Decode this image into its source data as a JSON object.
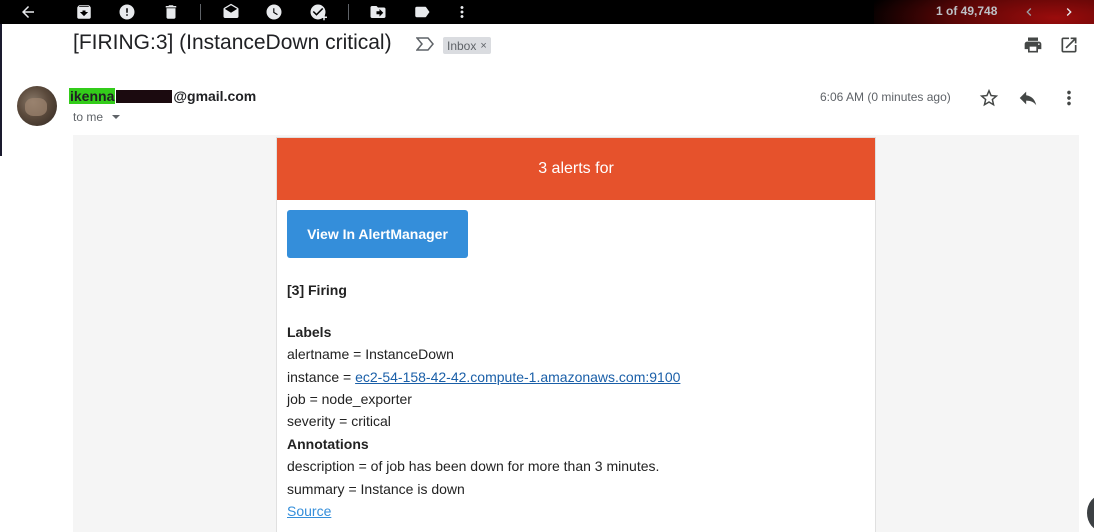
{
  "toolbar": {
    "page_count": "1 of 49,748",
    "icons": [
      "back-arrow-icon",
      "archive-icon",
      "report-spam-icon",
      "delete-icon",
      "mark-unread-icon",
      "snooze-icon",
      "add-to-tasks-icon",
      "move-to-icon",
      "label-icon",
      "more-vert-icon",
      "newer-icon",
      "older-icon"
    ]
  },
  "message": {
    "subject": "[FIRING:3] (InstanceDown critical)",
    "label_chip": "Inbox",
    "chip_close": "×",
    "sender_visible_start": "ikenna",
    "sender_visible_end": "@gmail.com",
    "recipient": "to me",
    "timestamp": "6:06 AM (0 minutes ago)"
  },
  "email": {
    "header_text": "3 alerts for",
    "header_color": "#e6522c",
    "button_label": "View In AlertManager",
    "button_color": "#348eda",
    "firing_title": "[3] Firing",
    "labels_heading": "Labels",
    "alertname": "alertname = InstanceDown",
    "instance_prefix": "instance = ",
    "instance_link": "ec2-54-158-42-42.compute-1.amazonaws.com:9100",
    "job": "job = node_exporter",
    "severity": "severity = critical",
    "annotations_heading": "Annotations",
    "description": "description = of job has been down for more than 3 minutes.",
    "summary": "summary = Instance is down",
    "source_link": "Source"
  }
}
